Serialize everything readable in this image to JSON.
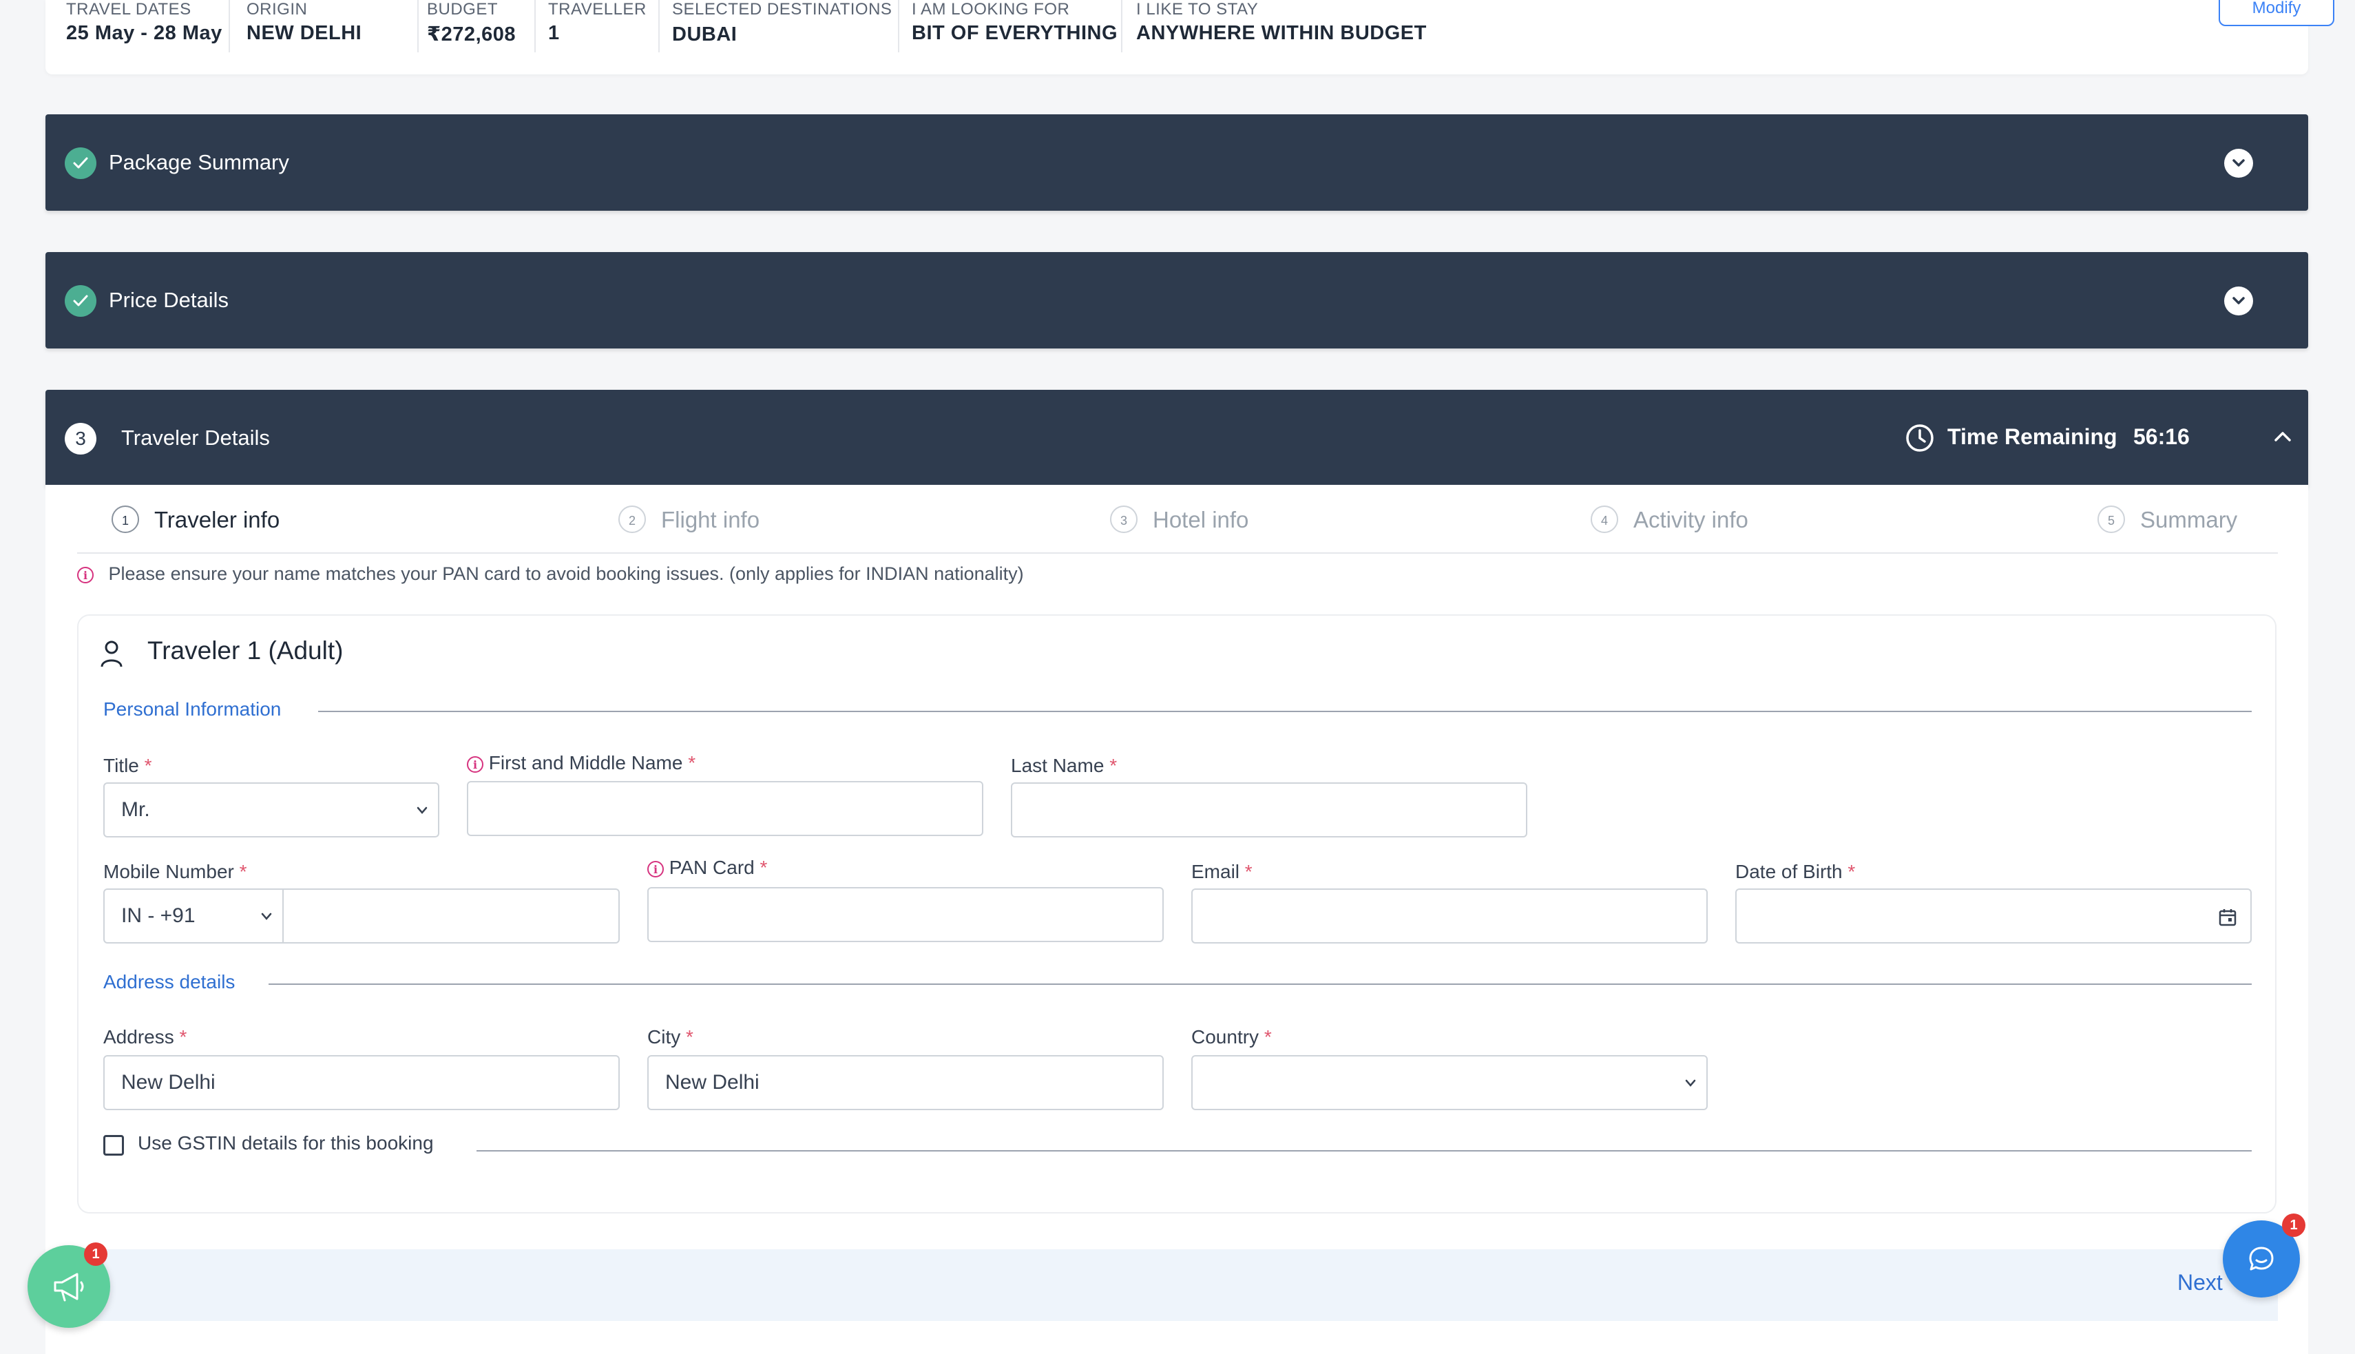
{
  "trip_summary": {
    "fields": [
      {
        "label": "TRAVEL DATES",
        "value": "25 May - 28 May"
      },
      {
        "label": "ORIGIN",
        "value": "NEW DELHI"
      },
      {
        "label": "BUDGET",
        "value": "₹272,608"
      },
      {
        "label": "TRAVELLER",
        "value": "1"
      },
      {
        "label": "SELECTED DESTINATIONS",
        "value": "DUBAI"
      },
      {
        "label": "I AM LOOKING FOR",
        "value": "BIT OF EVERYTHING"
      },
      {
        "label": "I LIKE TO STAY",
        "value": "ANYWHERE WITHIN BUDGET"
      }
    ],
    "modify_label": "Modify"
  },
  "sections": {
    "package_summary": {
      "title": "Package Summary",
      "status_icon": "check-icon"
    },
    "price_details": {
      "title": "Price Details",
      "status_icon": "check-icon"
    },
    "traveler_details": {
      "number": "3",
      "title": "Traveler Details",
      "timer_label": "Time Remaining",
      "timer_value": "56:16"
    }
  },
  "steps": [
    {
      "number": "1",
      "label": "Traveler info",
      "active": true
    },
    {
      "number": "2",
      "label": "Flight info",
      "active": false
    },
    {
      "number": "3",
      "label": "Hotel info",
      "active": false
    },
    {
      "number": "4",
      "label": "Activity info",
      "active": false
    },
    {
      "number": "5",
      "label": "Summary",
      "active": false
    }
  ],
  "notice": "Please ensure your name matches your PAN card to avoid booking issues. (only applies for INDIAN nationality)",
  "traveler_card": {
    "title": "Traveler 1 (Adult)",
    "personal_heading": "Personal Information",
    "address_heading": "Address details",
    "fields": {
      "title": {
        "label": "Title",
        "value": "Mr."
      },
      "first_name": {
        "label": "First and Middle Name",
        "value": ""
      },
      "last_name": {
        "label": "Last Name",
        "value": ""
      },
      "mobile": {
        "label": "Mobile Number",
        "country_code": "IN - +91",
        "value": ""
      },
      "pan": {
        "label": "PAN Card",
        "value": ""
      },
      "email": {
        "label": "Email",
        "value": ""
      },
      "dob": {
        "label": "Date of Birth",
        "value": ""
      },
      "address": {
        "label": "Address",
        "value": "New Delhi"
      },
      "city": {
        "label": "City",
        "value": "New Delhi"
      },
      "country": {
        "label": "Country",
        "value": ""
      }
    },
    "gstin_label": "Use GSTIN details for this booking",
    "required_marker": "*"
  },
  "footer": {
    "next_label": "Next"
  },
  "floating": {
    "announcement_badge": "1",
    "chat_badge": "1"
  },
  "colors": {
    "section_header": "#2e3b4e",
    "check_green": "#4cae92",
    "link_blue": "#2f6fd1",
    "required_red": "#e0566e",
    "info_magenta": "#d6337f"
  }
}
